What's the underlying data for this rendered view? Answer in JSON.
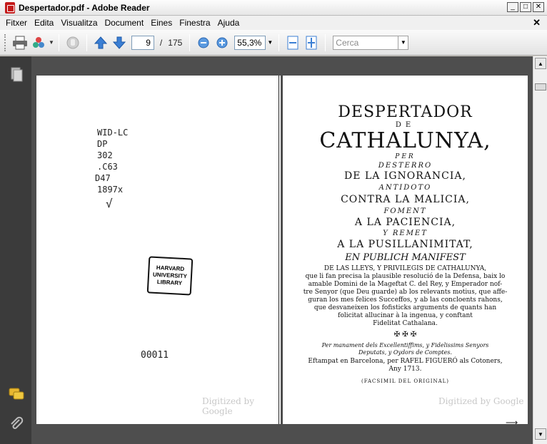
{
  "window": {
    "title": "Despertador.pdf - Adobe Reader",
    "btn_min": "_",
    "btn_max": "□",
    "btn_close": "✕"
  },
  "menu": {
    "items": [
      "Fitxer",
      "Edita",
      "Visualitza",
      "Document",
      "Eines",
      "Finestra",
      "Ajuda"
    ],
    "close": "✕"
  },
  "toolbar": {
    "page_current": "9",
    "page_total": "175",
    "page_sep": "/",
    "zoom": "55,3%",
    "search_placeholder": "Cerca",
    "icons": [
      "printer-icon",
      "share-icon",
      "hand-icon",
      "prev-page-icon",
      "next-page-icon",
      "zoom-out-icon",
      "zoom-in-icon",
      "fit-width-icon",
      "fit-page-icon"
    ]
  },
  "left_page": {
    "handwriting": [
      "WID-LC",
      "DP",
      "302",
      ".C63",
      "D47",
      "1897x",
      "√"
    ],
    "stamp": [
      "HARVARD",
      "UNIVERSITY",
      "LIBRARY"
    ],
    "number": "00011",
    "watermark": "Digitized by Google"
  },
  "right_page": {
    "title1": "DESPERTADOR",
    "de": "DE",
    "title2": "CATHALUNYA,",
    "per": "PER",
    "desterro": "DESTERRO",
    "line1": "DE LA IGNORANCIA,",
    "antidoto": "ANTIDOTO",
    "line2": "CONTRA LA MALICIA,",
    "foment": "FOMENT",
    "line3": "A LA PACIENCIA,",
    "remet": "Y REMET",
    "line4": "A LA PUSILLANIMITAT,",
    "manifest": "EN PUBLICH MANIFEST",
    "body": [
      "DE LAS LLEYS, Y PRIVILEGIS DE CATHALUNYA,",
      "que li fan precisa la plausible resolució de la Defensa, baix lo",
      "amable Domini de la Mageftat C. del Rey, y Emperador nof-",
      "tre Senyor (que Deu guarde) ab los relevants motius, que affe-",
      "guran los mes felices Succeffos, y ab las concloents rahons,",
      "que desvaneixen los fofisticks arguments de quants han",
      "folicitat allucinar à la ingenua, y conftant",
      "Fidelitat Cathalana."
    ],
    "ornament": "✠ ✠ ✠",
    "mandate": "Per manament dels Excellentiffims, y Fidelissims Senyors Deputats, y Oydors de Comptes.",
    "printer1": "Eftampat en Barcelona, per RAFEL FIGUERÓ als Cotoners,",
    "printer2": "Any 1713.",
    "facsimil": "(FACSIMIL DEL ORIGINAL)",
    "watermark": "Digitized by Google"
  }
}
